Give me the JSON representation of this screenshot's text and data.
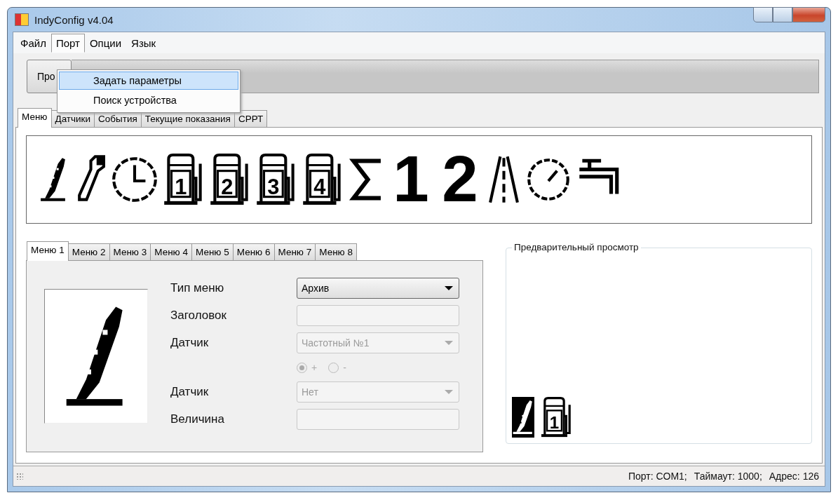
{
  "window": {
    "title": "IndyConfig v4.04"
  },
  "menu_bar": [
    {
      "label": "Файл",
      "open": false
    },
    {
      "label": "Порт",
      "open": true
    },
    {
      "label": "Опции",
      "open": false
    },
    {
      "label": "Язык",
      "open": false
    }
  ],
  "port_menu": [
    {
      "label": "Задать параметры",
      "selected": true
    },
    {
      "label": "Поиск устройства",
      "selected": false
    }
  ],
  "toolbar": {
    "button": "Про"
  },
  "tabs": [
    {
      "label": "Меню",
      "selected": true
    },
    {
      "label": "Датчики",
      "selected": false
    },
    {
      "label": "События",
      "selected": false
    },
    {
      "label": "Текущие показания",
      "selected": false
    },
    {
      "label": "СРРТ",
      "selected": false
    }
  ],
  "icon_strip": [
    {
      "kind": "pen"
    },
    {
      "kind": "wrench"
    },
    {
      "kind": "clock"
    },
    {
      "kind": "pump",
      "text": "1"
    },
    {
      "kind": "pump",
      "text": "2"
    },
    {
      "kind": "pump",
      "text": "3"
    },
    {
      "kind": "pump",
      "text": "4"
    },
    {
      "kind": "sigma"
    },
    {
      "kind": "digit",
      "text": "1"
    },
    {
      "kind": "digit",
      "text": "2"
    },
    {
      "kind": "road"
    },
    {
      "kind": "gauge"
    },
    {
      "kind": "tap"
    }
  ],
  "menu_tabs": [
    {
      "label": "Меню 1",
      "selected": true
    },
    {
      "label": "Меню 2",
      "selected": false
    },
    {
      "label": "Меню 3",
      "selected": false
    },
    {
      "label": "Меню 4",
      "selected": false
    },
    {
      "label": "Меню 5",
      "selected": false
    },
    {
      "label": "Меню 6",
      "selected": false
    },
    {
      "label": "Меню 7",
      "selected": false
    },
    {
      "label": "Меню 8",
      "selected": false
    }
  ],
  "menu_editor": {
    "icon": {
      "kind": "pen"
    },
    "fields": [
      {
        "kind": "combo",
        "label": "Тип меню",
        "value": "Архив",
        "disabled": false
      },
      {
        "kind": "text",
        "label": "Заголовок",
        "disabled": true
      },
      {
        "kind": "combo",
        "label": "Датчик",
        "value": "Частотный №1",
        "disabled": true
      },
      {
        "kind": "radios",
        "disabled": true,
        "options": [
          {
            "label": "+",
            "selected": true
          },
          {
            "label": "-",
            "selected": false
          }
        ]
      },
      {
        "kind": "combo",
        "label": "Датчик",
        "value": "Нет",
        "disabled": true
      },
      {
        "kind": "text",
        "label": "Величина",
        "disabled": true
      }
    ]
  },
  "preview": {
    "title": "Предварительный просмотр",
    "icons": [
      {
        "kind": "pen",
        "inverted": true
      },
      {
        "kind": "pump",
        "text": "1",
        "inverted": false
      }
    ]
  },
  "status_bar": {
    "port": "Порт: COM1;",
    "timeout": "Таймаут: 1000;",
    "address": "Адрес: 126"
  }
}
